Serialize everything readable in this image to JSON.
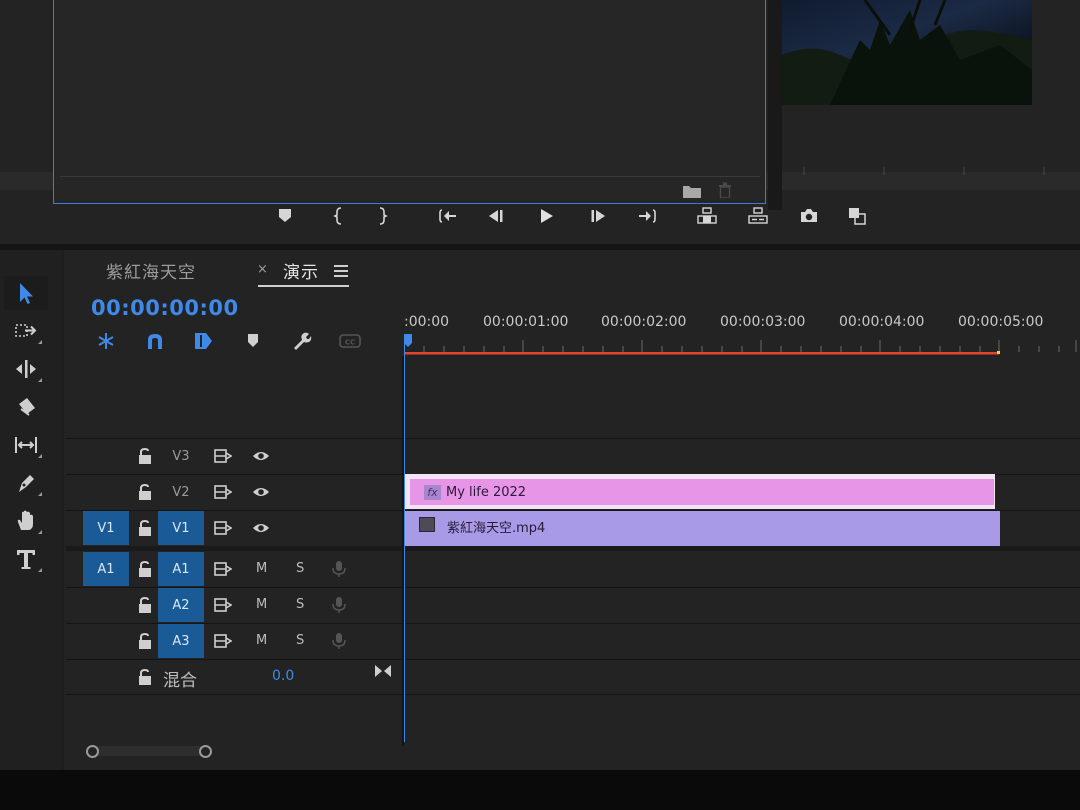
{
  "colors": {
    "accent": "#3f8ae8",
    "target_blue": "#1a5a96",
    "clip_title": "#e795e6",
    "clip_video": "#a89ae6",
    "work_area": "#e2452b"
  },
  "transport": {
    "icons": [
      "marker-icon",
      "mark-in-icon",
      "mark-out-icon",
      "go-to-in-icon",
      "step-back-icon",
      "play-icon",
      "step-forward-icon",
      "go-to-out-icon",
      "lift-icon",
      "extract-icon",
      "export-frame-icon",
      "compare-view-icon"
    ]
  },
  "tools": [
    "selection-tool-icon",
    "track-select-tool-icon",
    "ripple-edit-tool-icon",
    "razor-tool-icon",
    "slip-tool-icon",
    "pen-tool-icon",
    "hand-tool-icon",
    "type-tool-icon"
  ],
  "timeline": {
    "tabs": [
      {
        "label": "紫紅海天空"
      },
      {
        "label": "演示"
      }
    ],
    "close_glyph": "×",
    "timecode": "00:00:00:00",
    "ruler": [
      ":00:00",
      "00:00:01:00",
      "00:00:02:00",
      "00:00:03:00",
      "00:00:04:00",
      "00:00:05:00"
    ],
    "tracks": {
      "v3": {
        "label": "V3"
      },
      "v2": {
        "label": "V2"
      },
      "v1": {
        "label": "V1",
        "source": "V1"
      },
      "a1": {
        "label": "A1",
        "source": "A1",
        "m": "M",
        "s": "S"
      },
      "a2": {
        "label": "A2",
        "m": "M",
        "s": "S"
      },
      "a3": {
        "label": "A3",
        "m": "M",
        "s": "S"
      }
    },
    "mix": {
      "label": "混合",
      "value": "0.0"
    },
    "clips": [
      {
        "name": "My life 2022",
        "badge": "fx"
      },
      {
        "name": "紫紅海天空.mp4"
      }
    ]
  }
}
